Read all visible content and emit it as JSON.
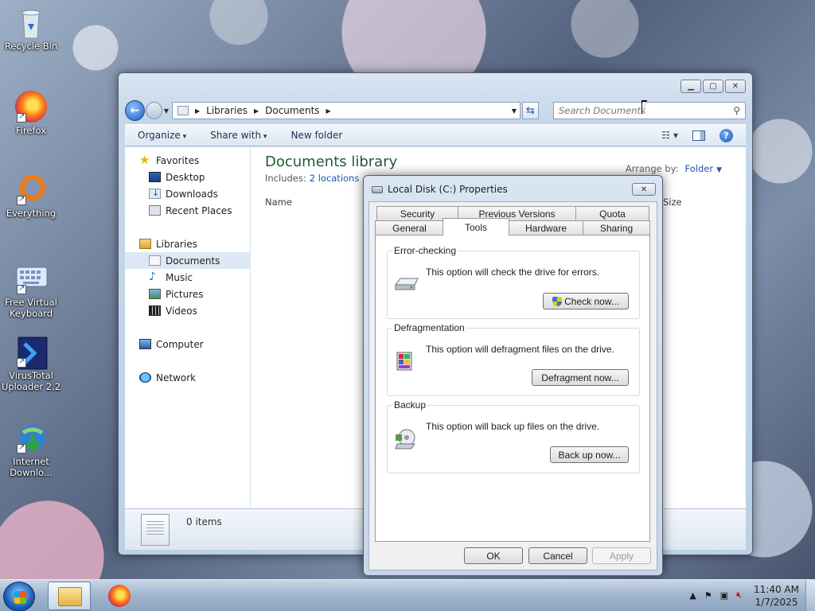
{
  "desktop": {
    "icons": [
      {
        "label": "Recycle Bin",
        "icon": "recycle-bin-icon"
      },
      {
        "label": "Firefox",
        "icon": "firefox-icon"
      },
      {
        "label": "Everything",
        "icon": "everything-icon"
      },
      {
        "label": "Free Virtual Keyboard",
        "icon": "keyboard-icon"
      },
      {
        "label": "VirusTotal Uploader 2.2",
        "icon": "virustotal-icon"
      },
      {
        "label": "Internet Downlo...",
        "icon": "download-manager-icon"
      }
    ]
  },
  "explorer": {
    "breadcrumb": [
      "Libraries",
      "Documents"
    ],
    "search_placeholder": "Search Documents",
    "toolbar": {
      "organize": "Organize",
      "share_with": "Share with",
      "new_folder": "New folder"
    },
    "nav": {
      "favorites": "Favorites",
      "desktop": "Desktop",
      "downloads": "Downloads",
      "recent_places": "Recent Places",
      "libraries": "Libraries",
      "documents": "Documents",
      "music": "Music",
      "pictures": "Pictures",
      "videos": "Videos",
      "computer": "Computer",
      "network": "Network"
    },
    "library": {
      "title": "Documents library",
      "includes_label": "Includes:",
      "includes_link": "2 locations",
      "arrange_label": "Arrange by:",
      "arrange_value": "Folder",
      "col_name": "Name",
      "col_size": "Size"
    },
    "details": {
      "count": "0 items"
    }
  },
  "dialog": {
    "title": "Local Disk (C:) Properties",
    "tabs_row1": [
      "Security",
      "Previous Versions",
      "Quota"
    ],
    "tabs_row2": [
      "General",
      "Tools",
      "Hardware",
      "Sharing"
    ],
    "active_tab": "Tools",
    "groups": {
      "error_checking": {
        "legend": "Error-checking",
        "desc": "This option will check the drive for errors.",
        "button": "Check now..."
      },
      "defrag": {
        "legend": "Defragmentation",
        "desc": "This option will defragment files on the drive.",
        "button": "Defragment now..."
      },
      "backup": {
        "legend": "Backup",
        "desc": "This option will back up files on the drive.",
        "button": "Back up now..."
      }
    },
    "buttons": {
      "ok": "OK",
      "cancel": "Cancel",
      "apply": "Apply"
    }
  },
  "taskbar": {
    "time": "11:40 AM",
    "date": "1/7/2025"
  }
}
